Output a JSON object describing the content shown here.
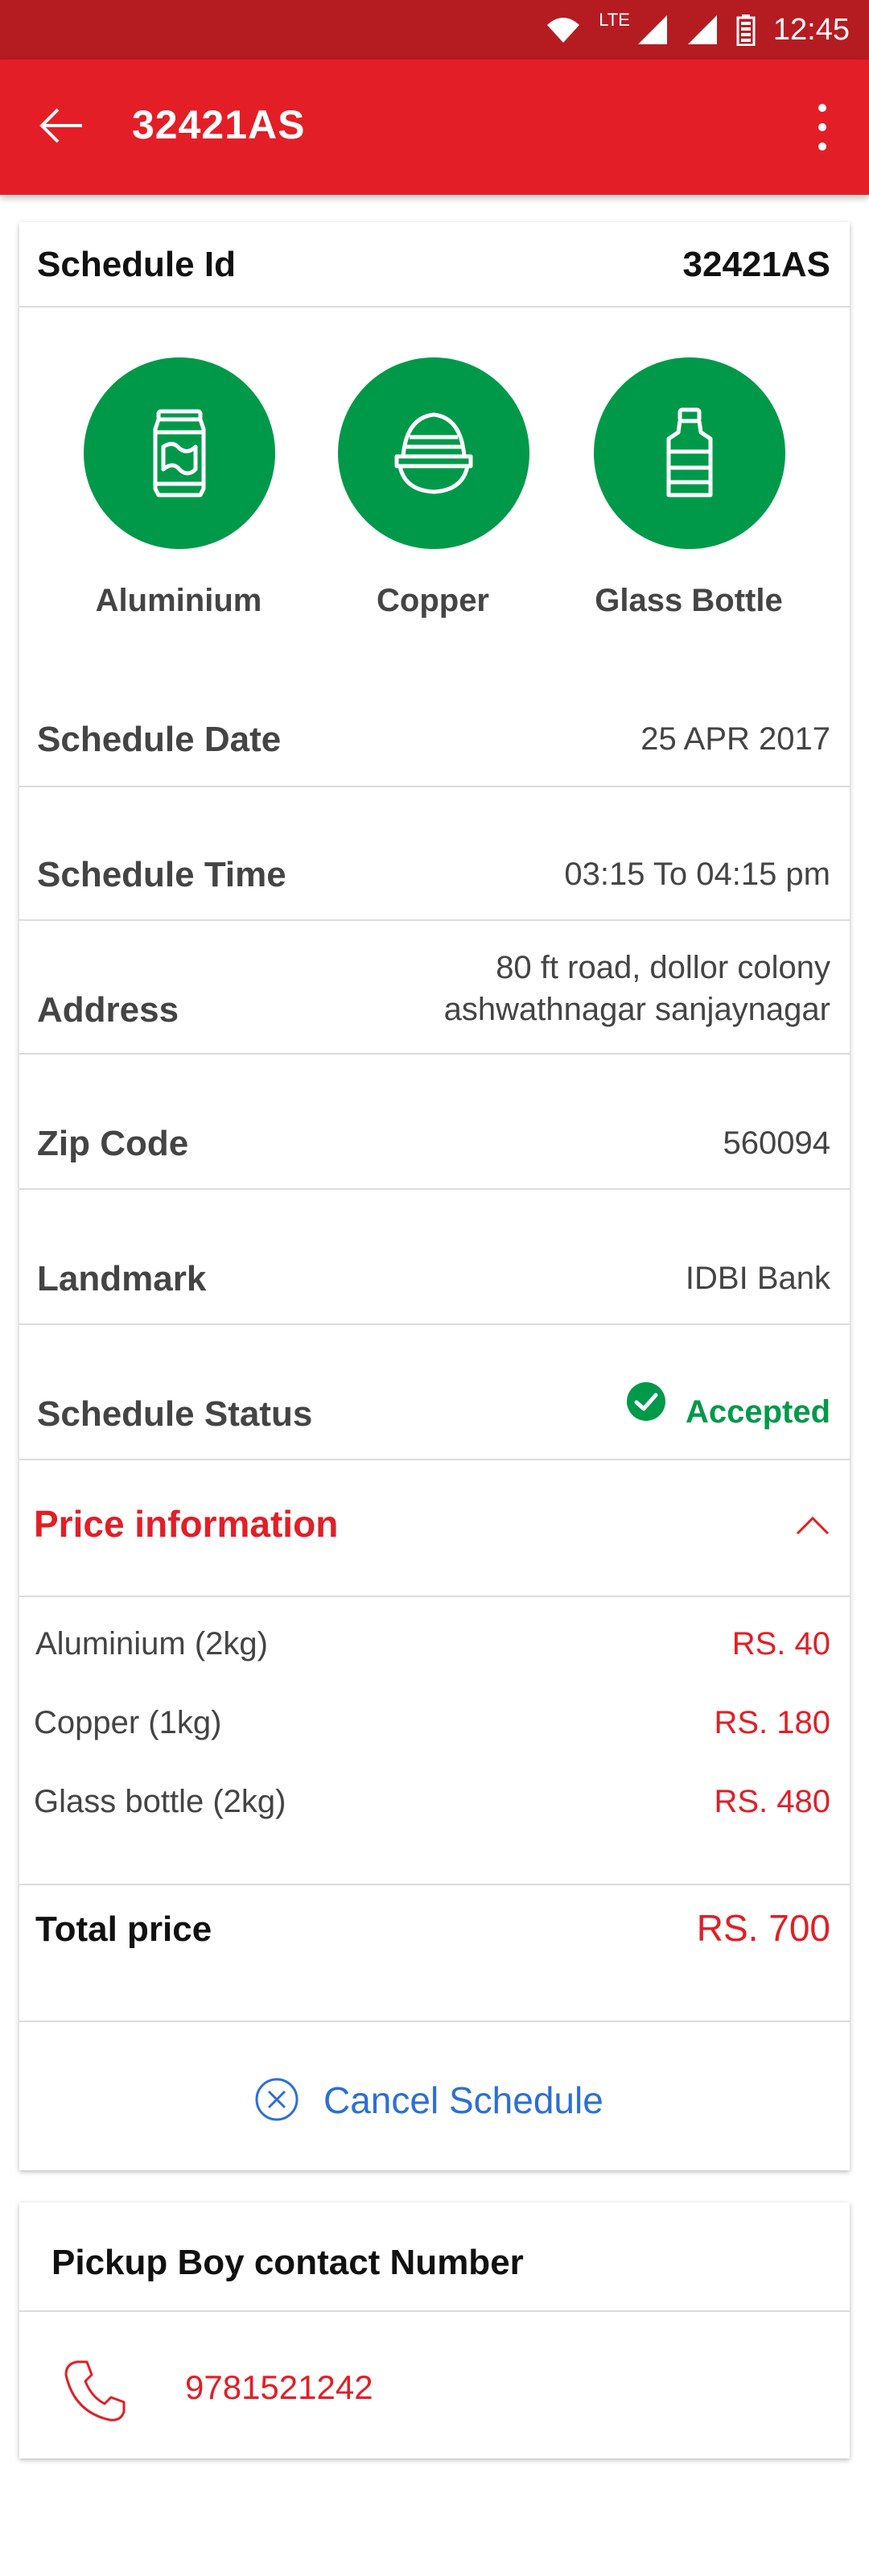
{
  "status_bar": {
    "network": "LTE",
    "time": "12:45"
  },
  "app_bar": {
    "title": "32421AS"
  },
  "schedule": {
    "id_label": "Schedule Id",
    "id_value": "32421AS",
    "materials": [
      {
        "label": "Aluminium",
        "icon": "can-icon"
      },
      {
        "label": "Copper",
        "icon": "copper-coil-icon"
      },
      {
        "label": "Glass Bottle",
        "icon": "bottle-icon"
      }
    ],
    "date_label": "Schedule Date",
    "date_value": "25 APR 2017",
    "time_label": "Schedule Time",
    "time_value": "03:15 To 04:15 pm",
    "address_label": "Address",
    "address_line1": "80 ft road, dollor colony",
    "address_line2": "ashwathnagar sanjaynagar",
    "zip_label": "Zip Code",
    "zip_value": "560094",
    "landmark_label": "Landmark",
    "landmark_value": "IDBI Bank",
    "status_label": "Schedule Status",
    "status_value": "Accepted"
  },
  "price": {
    "section_title": "Price information",
    "items": [
      {
        "name": "Aluminium (2kg)",
        "price": "RS. 40"
      },
      {
        "name": "Copper (1kg)",
        "price": "RS. 180"
      },
      {
        "name": "Glass bottle (2kg)",
        "price": "RS. 480"
      }
    ],
    "total_label": "Total price",
    "total_value": "RS. 700"
  },
  "cancel_label": "Cancel Schedule",
  "pickup": {
    "title": "Pickup Boy contact Number",
    "phone": "9781521242"
  },
  "colors": {
    "brand_red": "#e31e26",
    "status_bar": "#b51c22",
    "green": "#00994a",
    "link_blue": "#2c6fd6"
  }
}
